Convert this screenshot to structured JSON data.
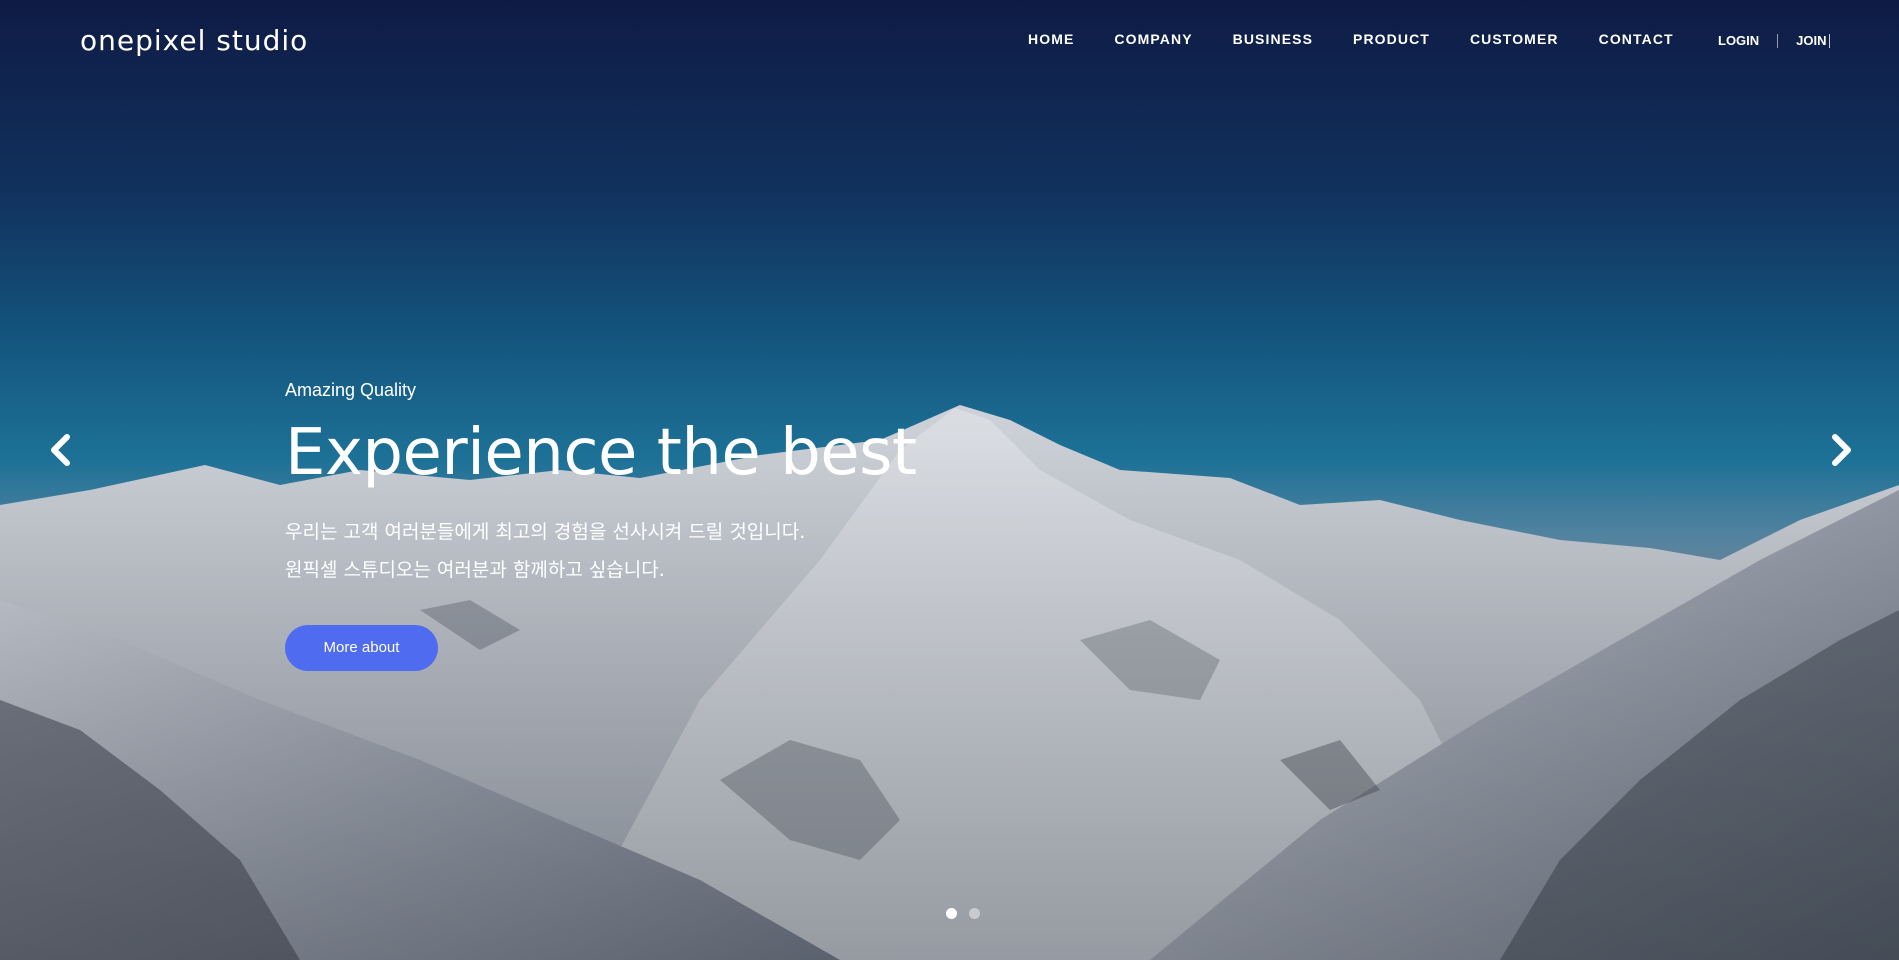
{
  "brand": {
    "logo_text": "onepixel studio"
  },
  "nav": {
    "items": [
      "HOME",
      "COMPANY",
      "BUSINESS",
      "PRODUCT",
      "CUSTOMER",
      "CONTACT"
    ]
  },
  "auth": {
    "login": "LOGIN",
    "join": "JOIN"
  },
  "hero": {
    "eyebrow": "Amazing Quality",
    "headline": "Experience the best",
    "description": [
      "우리는 고객 여러분들에게 최고의 경험을 선사시켜 드릴 것입니다.",
      "원픽셀 스튜디오는 여러분과 함께하고 싶습니다."
    ],
    "cta_label": "More about"
  },
  "slider": {
    "prev_icon": "chevron-left-icon",
    "next_icon": "chevron-right-icon",
    "active_slide": 1,
    "slide_count": 2
  },
  "colors": {
    "accent": "#4f6bf0",
    "sky_top": "#0f1d48",
    "sky_horizon": "#1f78a0",
    "text": "#ffffff"
  }
}
